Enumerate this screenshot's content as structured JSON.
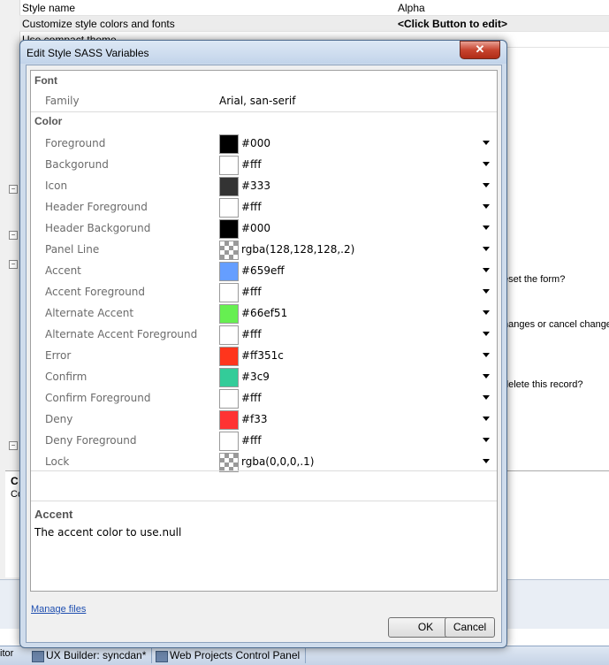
{
  "background": {
    "rows": [
      {
        "key": "Style name",
        "value": "Alpha"
      },
      {
        "key": "Customize style colors and fonts",
        "value": "<Click Button to edit>"
      },
      {
        "key": "Use compact theme",
        "value": ""
      }
    ],
    "right_texts": [
      "eset the form?",
      "hanges or cancel change",
      "delete this record?"
    ],
    "lower_panel_title": "C",
    "lower_panel_text": "Co",
    "left_edge_text": "itor",
    "taskbar": [
      {
        "label": "UX Builder: syncdan*",
        "icon": "window-icon"
      },
      {
        "label": "Web Projects Control Panel",
        "icon": "window-icon"
      }
    ]
  },
  "dialog": {
    "title": "Edit Style SASS Variables",
    "close_glyph": "✕",
    "groups": {
      "font": "Font",
      "color": "Color"
    },
    "font_rows": [
      {
        "label": "Family",
        "value": "Arial, san-serif"
      }
    ],
    "color_rows": [
      {
        "label": "Foreground",
        "value": "#000",
        "swatch": "#000000"
      },
      {
        "label": "Backgorund",
        "value": "#fff",
        "swatch": "#ffffff"
      },
      {
        "label": "Icon",
        "value": "#333",
        "swatch": "#333333"
      },
      {
        "label": "Header Foreground",
        "value": "#fff",
        "swatch": "#ffffff"
      },
      {
        "label": "Header Backgorund",
        "value": "#000",
        "swatch": "#000000"
      },
      {
        "label": "Panel Line",
        "value": "rgba(128,128,128,.2)",
        "swatch": "checker"
      },
      {
        "label": "Accent",
        "value": "#659eff",
        "swatch": "#659eff"
      },
      {
        "label": "Accent Foreground",
        "value": "#fff",
        "swatch": "#ffffff"
      },
      {
        "label": "Alternate Accent",
        "value": "#66ef51",
        "swatch": "#66ef51"
      },
      {
        "label": "Alternate Accent Foreground",
        "value": "#fff",
        "swatch": "#ffffff"
      },
      {
        "label": "Error",
        "value": "#ff351c",
        "swatch": "#ff351c"
      },
      {
        "label": "Confirm",
        "value": "#3c9",
        "swatch": "#33cc99"
      },
      {
        "label": "Confirm Foreground",
        "value": "#fff",
        "swatch": "#ffffff"
      },
      {
        "label": "Deny",
        "value": "#f33",
        "swatch": "#ff3333"
      },
      {
        "label": "Deny Foreground",
        "value": "#fff",
        "swatch": "#ffffff"
      },
      {
        "label": "Lock",
        "value": "rgba(0,0,0,.1)",
        "swatch": "checker"
      }
    ],
    "description": {
      "title": "Accent",
      "text": "The accent color to use.null"
    },
    "manage_link": "Manage files",
    "ok_label": "OK",
    "cancel_label": "Cancel"
  }
}
